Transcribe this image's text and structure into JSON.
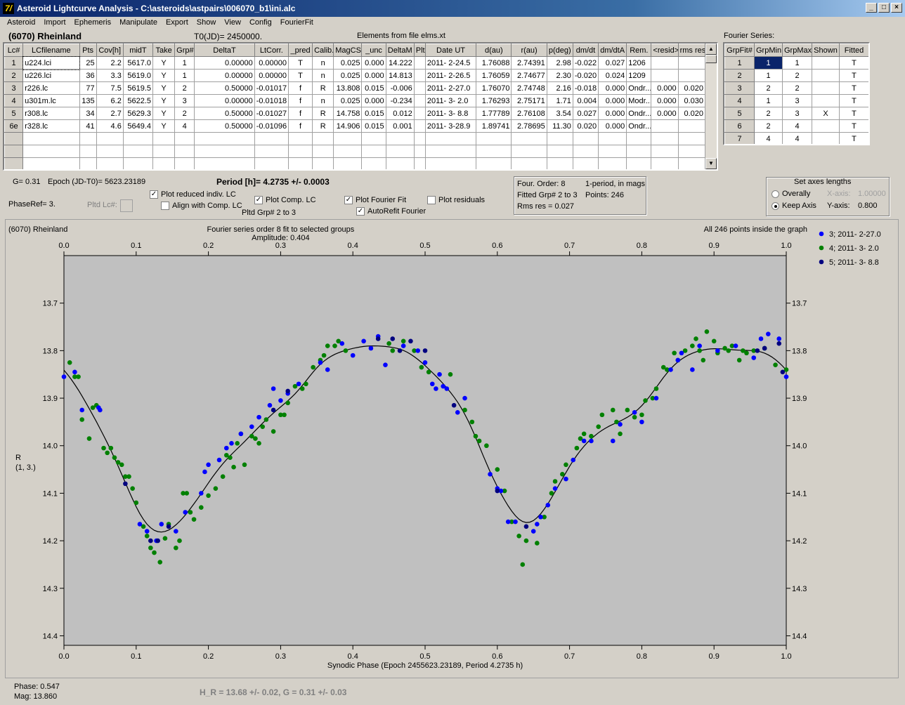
{
  "window": {
    "title": "Asteroid Lightcurve Analysis - C:\\asteroids\\astpairs\\006070_b1\\ini.alc",
    "icon_glyph": "7/"
  },
  "menu": [
    "Asteroid",
    "Import",
    "Ephemeris",
    "Manipulate",
    "Export",
    "Show",
    "View",
    "Config",
    "FourierFit"
  ],
  "header": {
    "asteroid": "(6070) Rheinland",
    "t0": "T0(JD)= 2450000.",
    "elements": "Elements from file elms.xt"
  },
  "lc_table": {
    "columns": [
      "Lc#",
      "LCfilename",
      "Pts",
      "Cov[h]",
      "midT",
      "Take",
      "Grp#",
      "DeltaT",
      "LtCorr.",
      "_pred",
      "Calib.",
      "MagCS",
      "_unc",
      "DeltaM",
      "Plt",
      "Date UT",
      "d(au)",
      "r(au)",
      "p(deg)",
      "dm/dt",
      "dm/dtA",
      "Rem.",
      "<resid>",
      "rms res"
    ],
    "rows": [
      [
        "1",
        "u224.lci",
        "25",
        "2.2",
        "5617.0",
        "Y",
        "1",
        "0.00000",
        "0.00000",
        "T",
        "n",
        "0.025",
        "0.000",
        "14.222",
        "",
        "2011- 2-24.5",
        "1.76088",
        "2.74391",
        "2.98",
        "-0.022",
        "0.027",
        "1206",
        "",
        ""
      ],
      [
        "2",
        "u226.lci",
        "36",
        "3.3",
        "5619.0",
        "Y",
        "1",
        "0.00000",
        "0.00000",
        "T",
        "n",
        "0.025",
        "0.000",
        "14.813",
        "",
        "2011- 2-26.5",
        "1.76059",
        "2.74677",
        "2.30",
        "-0.020",
        "0.024",
        "1209",
        "",
        ""
      ],
      [
        "3",
        "r226.lc",
        "77",
        "7.5",
        "5619.5",
        "Y",
        "2",
        "0.50000",
        "-0.01017",
        "f",
        "R",
        "13.808",
        "0.015",
        "-0.006",
        "",
        "2011- 2-27.0",
        "1.76070",
        "2.74748",
        "2.16",
        "-0.018",
        "0.000",
        "Ondr...",
        "0.000",
        "0.020"
      ],
      [
        "4",
        "u301m.lc",
        "135",
        "6.2",
        "5622.5",
        "Y",
        "3",
        "0.00000",
        "-0.01018",
        "f",
        "n",
        "0.025",
        "0.000",
        "-0.234",
        "",
        "2011- 3- 2.0",
        "1.76293",
        "2.75171",
        "1.71",
        "0.004",
        "0.000",
        "Modr...",
        "0.000",
        "0.030"
      ],
      [
        "5",
        "r308.lc",
        "34",
        "2.7",
        "5629.3",
        "Y",
        "2",
        "0.50000",
        "-0.01027",
        "f",
        "R",
        "14.758",
        "0.015",
        "0.012",
        "",
        "2011- 3- 8.8",
        "1.77789",
        "2.76108",
        "3.54",
        "0.027",
        "0.000",
        "Ondr...",
        "0.000",
        "0.020"
      ],
      [
        "6e",
        "r328.lc",
        "41",
        "4.6",
        "5649.4",
        "Y",
        "4",
        "0.50000",
        "-0.01096",
        "f",
        "R",
        "14.906",
        "0.015",
        "0.001",
        "",
        "2011- 3-28.9",
        "1.89741",
        "2.78695",
        "11.30",
        "0.020",
        "0.000",
        "Ondr...",
        "",
        ""
      ]
    ]
  },
  "fourier_table": {
    "title": "Fourier Series:",
    "columns": [
      "GrpFit#",
      "GrpMin",
      "GrpMax",
      "Shown",
      "Fitted"
    ],
    "rows": [
      [
        "1",
        "1",
        "1",
        "",
        "T"
      ],
      [
        "2",
        "1",
        "2",
        "",
        "T"
      ],
      [
        "3",
        "2",
        "2",
        "",
        "T"
      ],
      [
        "4",
        "1",
        "3",
        "",
        "T"
      ],
      [
        "5",
        "2",
        "3",
        "X",
        "T"
      ],
      [
        "6",
        "2",
        "4",
        "",
        "T"
      ],
      [
        "7",
        "4",
        "4",
        "",
        "T"
      ]
    ]
  },
  "controls": {
    "g": "G= 0.31",
    "epoch": "Epoch (JD-T0)= 5623.23189",
    "period": "Period [h]= 4.2735 +/- 0.0003",
    "phaseref": "PhaseRef= 3.",
    "pltd_lc": "Pltd Lc#:",
    "plot_reduced": "Plot reduced indiv. LC",
    "align_comp": "Align with Comp. LC",
    "plot_comp": "Plot Comp. LC",
    "pltd_grp": "Pltd Grp#  2   to    3",
    "plot_fourier": "Plot Fourier Fit",
    "autorefit": "AutoRefit Fourier",
    "plot_resid": "Plot residuals",
    "four_order": "Four. Order:  8",
    "one_period": "1-period, in mags",
    "fitted_grp": "Fitted Grp# 2 to 3",
    "points": "Points: 246",
    "rms": "Rms res     = 0.027",
    "axes_title": "Set axes lengths",
    "overally": "Overally",
    "keep_axis": "Keep Axis",
    "x_axis_label": "X-axis:",
    "x_axis_val": "1.00000",
    "y_axis_label": "Y-axis:",
    "y_axis_val": "0.800"
  },
  "plot_header": {
    "left": "(6070) Rheinland",
    "center1": "Fourier series order 8 fit to selected groups",
    "center2": "Amplitude: 0.404",
    "right": "All 246 points inside the graph"
  },
  "footer": {
    "phase": "Phase:  0.547",
    "mag": "Mag:    13.860",
    "hr": "H_R = 13.68 +/- 0.02, G = 0.31 +/- 0.03"
  },
  "colors": {
    "s3": "#0000ff",
    "s4": "#008000",
    "s5": "#000080",
    "plot_bg": "#c0c0c0"
  },
  "chart_data": {
    "type": "scatter",
    "xlabel": "Synodic Phase (Epoch 2455623.23189, Period 4.2735 h)",
    "ylabel": "R",
    "ylabel2": "(1, 3.)",
    "xlim": [
      0,
      1
    ],
    "ylim": [
      14.42,
      13.6
    ],
    "xticks": [
      "0.0",
      "0.1",
      "0.2",
      "0.3",
      "0.4",
      "0.5",
      "0.6",
      "0.7",
      "0.8",
      "0.9",
      "1.0"
    ],
    "yticks": [
      "13.7",
      "13.8",
      "13.9",
      "14.0",
      "14.1",
      "14.2",
      "14.3",
      "14.4"
    ],
    "series": [
      {
        "name": "3; 2011- 2-27.0",
        "points": [
          [
            0.0,
            13.855
          ],
          [
            0.015,
            13.845
          ],
          [
            0.025,
            13.925
          ],
          [
            0.048,
            13.92
          ],
          [
            0.05,
            13.925
          ],
          [
            0.105,
            14.165
          ],
          [
            0.115,
            14.18
          ],
          [
            0.128,
            14.2
          ],
          [
            0.135,
            14.165
          ],
          [
            0.155,
            14.18
          ],
          [
            0.168,
            14.14
          ],
          [
            0.19,
            14.1
          ],
          [
            0.195,
            14.055
          ],
          [
            0.2,
            14.04
          ],
          [
            0.215,
            14.03
          ],
          [
            0.225,
            14.005
          ],
          [
            0.232,
            13.995
          ],
          [
            0.245,
            13.975
          ],
          [
            0.26,
            13.96
          ],
          [
            0.27,
            13.94
          ],
          [
            0.285,
            13.915
          ],
          [
            0.29,
            13.88
          ],
          [
            0.3,
            13.905
          ],
          [
            0.31,
            13.89
          ],
          [
            0.325,
            13.87
          ],
          [
            0.355,
            13.825
          ],
          [
            0.365,
            13.84
          ],
          [
            0.385,
            13.785
          ],
          [
            0.4,
            13.81
          ],
          [
            0.415,
            13.78
          ],
          [
            0.425,
            13.795
          ],
          [
            0.435,
            13.77
          ],
          [
            0.445,
            13.83
          ],
          [
            0.47,
            13.79
          ],
          [
            0.49,
            13.8
          ],
          [
            0.5,
            13.825
          ],
          [
            0.51,
            13.87
          ],
          [
            0.515,
            13.88
          ],
          [
            0.52,
            13.85
          ],
          [
            0.525,
            13.875
          ],
          [
            0.53,
            13.88
          ],
          [
            0.545,
            13.93
          ],
          [
            0.555,
            13.9
          ],
          [
            0.59,
            14.06
          ],
          [
            0.6,
            14.09
          ],
          [
            0.605,
            14.095
          ],
          [
            0.615,
            14.16
          ],
          [
            0.625,
            14.16
          ],
          [
            0.65,
            14.18
          ],
          [
            0.655,
            14.165
          ],
          [
            0.66,
            14.15
          ],
          [
            0.67,
            14.125
          ],
          [
            0.68,
            14.09
          ],
          [
            0.695,
            14.07
          ],
          [
            0.705,
            14.03
          ],
          [
            0.72,
            13.99
          ],
          [
            0.73,
            13.99
          ],
          [
            0.76,
            13.99
          ],
          [
            0.77,
            13.955
          ],
          [
            0.79,
            13.93
          ],
          [
            0.8,
            13.95
          ],
          [
            0.82,
            13.9
          ],
          [
            0.84,
            13.84
          ],
          [
            0.85,
            13.82
          ],
          [
            0.855,
            13.805
          ],
          [
            0.87,
            13.84
          ],
          [
            0.88,
            13.79
          ],
          [
            0.905,
            13.8
          ],
          [
            0.93,
            13.79
          ],
          [
            0.955,
            13.815
          ],
          [
            0.965,
            13.775
          ],
          [
            0.975,
            13.765
          ],
          [
            0.99,
            13.775
          ],
          [
            1.0,
            13.855
          ]
        ]
      },
      {
        "name": "4; 2011- 3- 2.0",
        "points": [
          [
            0.008,
            13.825
          ],
          [
            0.015,
            13.855
          ],
          [
            0.02,
            13.855
          ],
          [
            0.025,
            13.945
          ],
          [
            0.035,
            13.985
          ],
          [
            0.04,
            13.92
          ],
          [
            0.045,
            13.915
          ],
          [
            0.055,
            14.005
          ],
          [
            0.06,
            14.015
          ],
          [
            0.065,
            14.005
          ],
          [
            0.07,
            14.025
          ],
          [
            0.075,
            14.035
          ],
          [
            0.08,
            14.04
          ],
          [
            0.085,
            14.065
          ],
          [
            0.09,
            14.065
          ],
          [
            0.095,
            14.09
          ],
          [
            0.1,
            14.12
          ],
          [
            0.11,
            14.17
          ],
          [
            0.115,
            14.19
          ],
          [
            0.12,
            14.215
          ],
          [
            0.125,
            14.225
          ],
          [
            0.133,
            14.245
          ],
          [
            0.14,
            14.195
          ],
          [
            0.145,
            14.165
          ],
          [
            0.155,
            14.215
          ],
          [
            0.16,
            14.2
          ],
          [
            0.165,
            14.1
          ],
          [
            0.17,
            14.1
          ],
          [
            0.175,
            14.14
          ],
          [
            0.18,
            14.155
          ],
          [
            0.19,
            14.13
          ],
          [
            0.2,
            14.105
          ],
          [
            0.21,
            14.09
          ],
          [
            0.22,
            14.065
          ],
          [
            0.225,
            14.02
          ],
          [
            0.23,
            14.025
          ],
          [
            0.235,
            14.045
          ],
          [
            0.24,
            13.995
          ],
          [
            0.245,
            13.975
          ],
          [
            0.25,
            14.04
          ],
          [
            0.26,
            13.98
          ],
          [
            0.265,
            13.985
          ],
          [
            0.27,
            13.995
          ],
          [
            0.275,
            13.96
          ],
          [
            0.28,
            13.945
          ],
          [
            0.29,
            13.97
          ],
          [
            0.3,
            13.935
          ],
          [
            0.305,
            13.935
          ],
          [
            0.31,
            13.91
          ],
          [
            0.32,
            13.875
          ],
          [
            0.33,
            13.88
          ],
          [
            0.335,
            13.87
          ],
          [
            0.345,
            13.835
          ],
          [
            0.355,
            13.82
          ],
          [
            0.36,
            13.81
          ],
          [
            0.365,
            13.79
          ],
          [
            0.375,
            13.79
          ],
          [
            0.38,
            13.78
          ],
          [
            0.39,
            13.8
          ],
          [
            0.45,
            13.785
          ],
          [
            0.455,
            13.8
          ],
          [
            0.47,
            13.78
          ],
          [
            0.485,
            13.8
          ],
          [
            0.495,
            13.835
          ],
          [
            0.505,
            13.845
          ],
          [
            0.535,
            13.85
          ],
          [
            0.555,
            13.925
          ],
          [
            0.565,
            13.95
          ],
          [
            0.57,
            13.98
          ],
          [
            0.575,
            13.99
          ],
          [
            0.585,
            14.0
          ],
          [
            0.6,
            14.05
          ],
          [
            0.61,
            14.095
          ],
          [
            0.62,
            14.16
          ],
          [
            0.63,
            14.19
          ],
          [
            0.635,
            14.25
          ],
          [
            0.64,
            14.2
          ],
          [
            0.655,
            14.205
          ],
          [
            0.665,
            14.15
          ],
          [
            0.675,
            14.1
          ],
          [
            0.68,
            14.075
          ],
          [
            0.69,
            14.06
          ],
          [
            0.695,
            14.04
          ],
          [
            0.71,
            14.005
          ],
          [
            0.715,
            13.985
          ],
          [
            0.72,
            13.975
          ],
          [
            0.73,
            13.98
          ],
          [
            0.74,
            13.96
          ],
          [
            0.745,
            13.935
          ],
          [
            0.76,
            13.925
          ],
          [
            0.765,
            13.95
          ],
          [
            0.77,
            13.975
          ],
          [
            0.78,
            13.925
          ],
          [
            0.79,
            13.94
          ],
          [
            0.8,
            13.935
          ],
          [
            0.805,
            13.905
          ],
          [
            0.815,
            13.9
          ],
          [
            0.82,
            13.88
          ],
          [
            0.83,
            13.835
          ],
          [
            0.835,
            13.84
          ],
          [
            0.845,
            13.805
          ],
          [
            0.85,
            13.82
          ],
          [
            0.86,
            13.8
          ],
          [
            0.87,
            13.79
          ],
          [
            0.875,
            13.775
          ],
          [
            0.88,
            13.8
          ],
          [
            0.885,
            13.82
          ],
          [
            0.89,
            13.76
          ],
          [
            0.9,
            13.78
          ],
          [
            0.905,
            13.805
          ],
          [
            0.915,
            13.795
          ],
          [
            0.92,
            13.8
          ],
          [
            0.925,
            13.79
          ],
          [
            0.935,
            13.82
          ],
          [
            0.94,
            13.8
          ],
          [
            0.945,
            13.805
          ],
          [
            0.955,
            13.8
          ],
          [
            0.97,
            13.795
          ],
          [
            0.985,
            13.83
          ],
          [
            1.0,
            13.84
          ]
        ]
      },
      {
        "name": "5; 2011- 3- 8.8",
        "points": [
          [
            0.085,
            14.08
          ],
          [
            0.12,
            14.2
          ],
          [
            0.13,
            14.2
          ],
          [
            0.145,
            14.17
          ],
          [
            0.29,
            13.925
          ],
          [
            0.31,
            13.885
          ],
          [
            0.435,
            13.775
          ],
          [
            0.455,
            13.775
          ],
          [
            0.465,
            13.8
          ],
          [
            0.48,
            13.78
          ],
          [
            0.5,
            13.8
          ],
          [
            0.54,
            13.915
          ],
          [
            0.6,
            14.095
          ],
          [
            0.64,
            14.17
          ],
          [
            0.96,
            13.8
          ],
          [
            0.97,
            13.795
          ],
          [
            0.99,
            13.785
          ],
          [
            0.995,
            13.845
          ]
        ]
      }
    ]
  }
}
